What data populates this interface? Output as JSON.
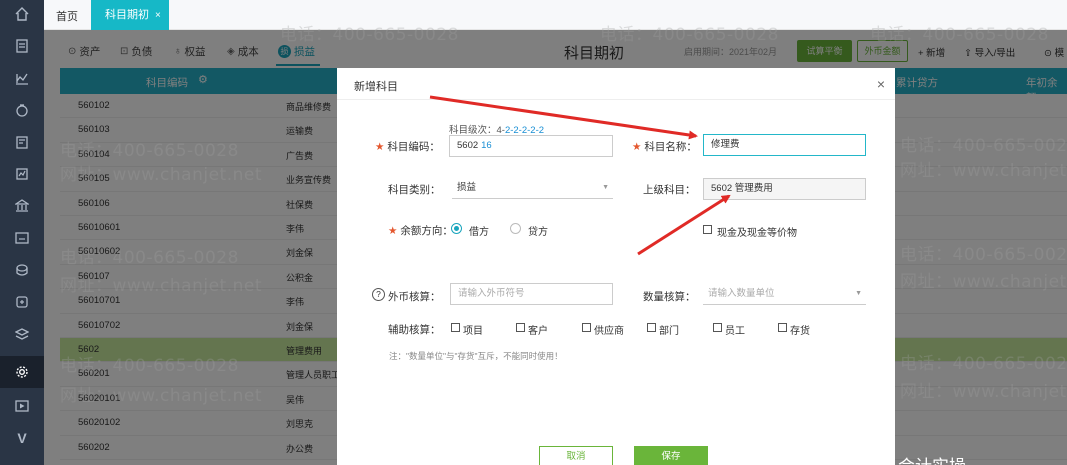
{
  "tabs": {
    "home": "首页",
    "active": "科目期初",
    "close": "×"
  },
  "categories": [
    {
      "label": "资产",
      "icon": "⊙"
    },
    {
      "label": "负债",
      "icon": "⊡"
    },
    {
      "label": "权益",
      "icon": "♁"
    },
    {
      "label": "成本",
      "icon": "◈"
    },
    {
      "label": "损益",
      "icon": "损"
    }
  ],
  "page_title": "科目期初",
  "enable_date": "启用期间：2021年02月",
  "actions": {
    "trial_balance": "试算平衡",
    "fx_amount": "外币金额",
    "add": "+ 新增",
    "import_export": "⇪ 导入/导出",
    "more": "⊙ 模"
  },
  "table": {
    "headers": {
      "code": "科目编码",
      "cum_credit": "累计贷方",
      "year_begin": "年初余额"
    },
    "rows": [
      {
        "code": "560102",
        "name": "商品维修费",
        "highlight": false
      },
      {
        "code": "560103",
        "name": "运输费",
        "highlight": false
      },
      {
        "code": "560104",
        "name": "广告费",
        "highlight": false
      },
      {
        "code": "560105",
        "name": "业务宣传费",
        "highlight": false
      },
      {
        "code": "560106",
        "name": "社保费",
        "highlight": false
      },
      {
        "code": "56010601",
        "name": "李伟",
        "highlight": false
      },
      {
        "code": "56010602",
        "name": "刘金保",
        "highlight": false
      },
      {
        "code": "560107",
        "name": "公积金",
        "highlight": false
      },
      {
        "code": "56010701",
        "name": "李伟",
        "highlight": false
      },
      {
        "code": "56010702",
        "name": "刘金保",
        "highlight": false
      },
      {
        "code": "5602",
        "name": "管理费用",
        "highlight": true
      },
      {
        "code": "560201",
        "name": "管理人员职工",
        "highlight": false
      },
      {
        "code": "56020101",
        "name": "吴伟",
        "highlight": false
      },
      {
        "code": "56020102",
        "name": "刘思克",
        "highlight": false
      },
      {
        "code": "560202",
        "name": "办公费",
        "highlight": false
      }
    ]
  },
  "modal": {
    "title": "新增科目",
    "close": "×",
    "level_hint_prefix": "科目级次：4-",
    "level_hint_rest": "2-2-2-2-2",
    "code_label": "科目编码：",
    "code_prefix": "5602",
    "code_suffix": "16",
    "name_label": "科目名称：",
    "name_value": "修理费",
    "type_label": "科目类别：",
    "type_value": "损益",
    "parent_label": "上级科目：",
    "parent_value": "5602 管理费用",
    "direction_label": "余额方向：",
    "debit": "借方",
    "credit": "贷方",
    "cash_equiv": "现金及现金等价物",
    "fx_label": "外币核算：",
    "fx_placeholder": "请输入外币符号",
    "qty_label": "数量核算：",
    "qty_placeholder": "请输入数量单位",
    "aux_label": "辅助核算：",
    "aux_items": [
      "项目",
      "客户",
      "供应商",
      "部门",
      "员工",
      "存货"
    ],
    "note": "注：\"数量单位\"与\"存货\"互斥，不能同时使用！",
    "cancel": "取消",
    "save": "保存"
  },
  "watermark": {
    "phone": "电话：400-665-0028",
    "site": "网址：www.chanjet.net"
  },
  "brand_tail": "会计实操"
}
